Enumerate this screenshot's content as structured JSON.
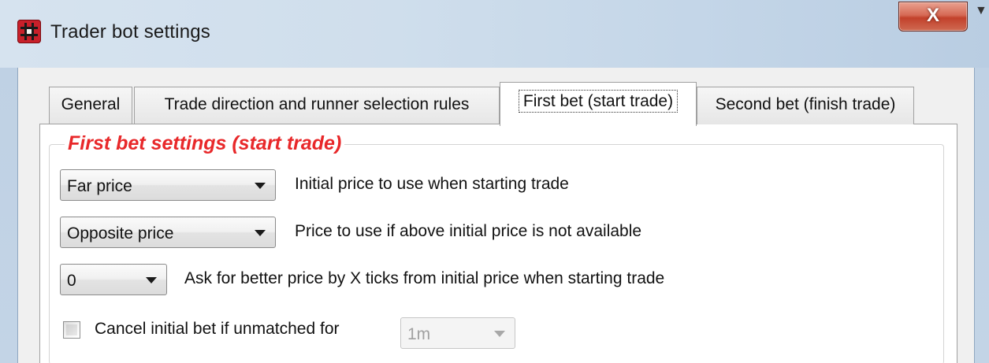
{
  "window": {
    "title": "Trader bot settings",
    "close_label": "X"
  },
  "tabs": [
    {
      "label": "General"
    },
    {
      "label": "Trade direction and runner selection rules"
    },
    {
      "label": "First bet (start trade)",
      "active": true
    },
    {
      "label": "Second bet (finish trade)"
    }
  ],
  "group": {
    "title": "First bet settings (start trade)"
  },
  "settings": {
    "initial_price": {
      "value": "Far price",
      "label": "Initial price to use when starting trade"
    },
    "fallback_price": {
      "value": "Opposite price",
      "label": "Price to use if above initial price is not available"
    },
    "better_price_ticks": {
      "value": "0",
      "label": "Ask for better price by X ticks from initial price when starting trade"
    },
    "cancel_unmatched": {
      "checked": false,
      "label": "Cancel initial bet if unmatched for",
      "duration_value": "1m"
    }
  },
  "colors": {
    "group_title": "#e8282a",
    "close_button": "#c2412b",
    "app_icon": "#c8202a"
  },
  "icons": {
    "app": "grid-app-icon",
    "dropdown": "chevron-down-icon"
  }
}
